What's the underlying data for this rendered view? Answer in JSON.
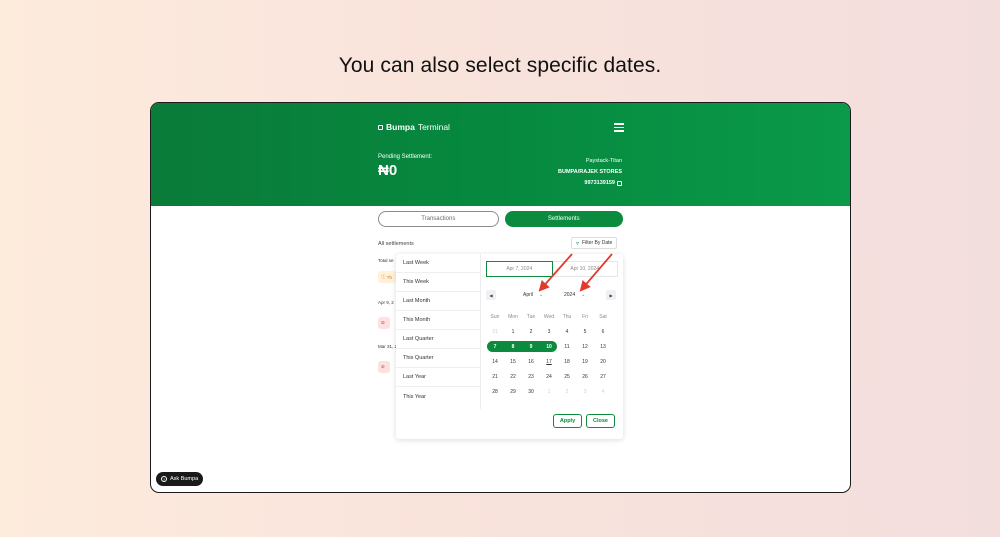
{
  "headline": "You can also select specific dates.",
  "header": {
    "brand_bold": "Bumpa",
    "brand_sub": "Terminal",
    "pending_label": "Pending Settlement:",
    "pending_value": "₦0",
    "provider": "Paystack-Titan",
    "account_name": "BUMPA/RAJEK STORES",
    "account_number": "9973139159"
  },
  "tabs": [
    {
      "label": "Transactions",
      "active": false
    },
    {
      "label": "Settlements",
      "active": true
    }
  ],
  "list": {
    "title": "All settlements",
    "filter_label": "Filter By Date",
    "total_label": "Total se",
    "badge_text": "Th",
    "date_1": "Apr 9, 2",
    "date_2": "Mar 31, 2"
  },
  "presets": [
    "Last Week",
    "This Week",
    "Last Month",
    "This Month",
    "Last Quarter",
    "This Quarter",
    "Last Year",
    "This Year"
  ],
  "range": {
    "from": "Apr 7, 2024",
    "to": "Apr 10, 2024"
  },
  "calendar": {
    "month": "April",
    "year": "2024",
    "weekdays": [
      "Sun",
      "Mon",
      "Tue",
      "Wed",
      "Thu",
      "Fri",
      "Sat"
    ],
    "weeks": [
      [
        "31",
        "1",
        "2",
        "3",
        "4",
        "5",
        "6"
      ],
      [
        "7",
        "8",
        "9",
        "10",
        "11",
        "12",
        "13"
      ],
      [
        "14",
        "15",
        "16",
        "17",
        "18",
        "19",
        "20"
      ],
      [
        "21",
        "22",
        "23",
        "24",
        "25",
        "26",
        "27"
      ],
      [
        "28",
        "29",
        "30",
        "1",
        "2",
        "3",
        "4"
      ]
    ],
    "selected_range": [
      "7",
      "8",
      "9",
      "10"
    ],
    "today": "17"
  },
  "buttons": {
    "apply": "Apply",
    "close": "Close"
  },
  "ask_bumpa": "Ask Bumpa",
  "colors": {
    "brand_green": "#0c8a3e",
    "annotation_red": "#e23b2e"
  }
}
